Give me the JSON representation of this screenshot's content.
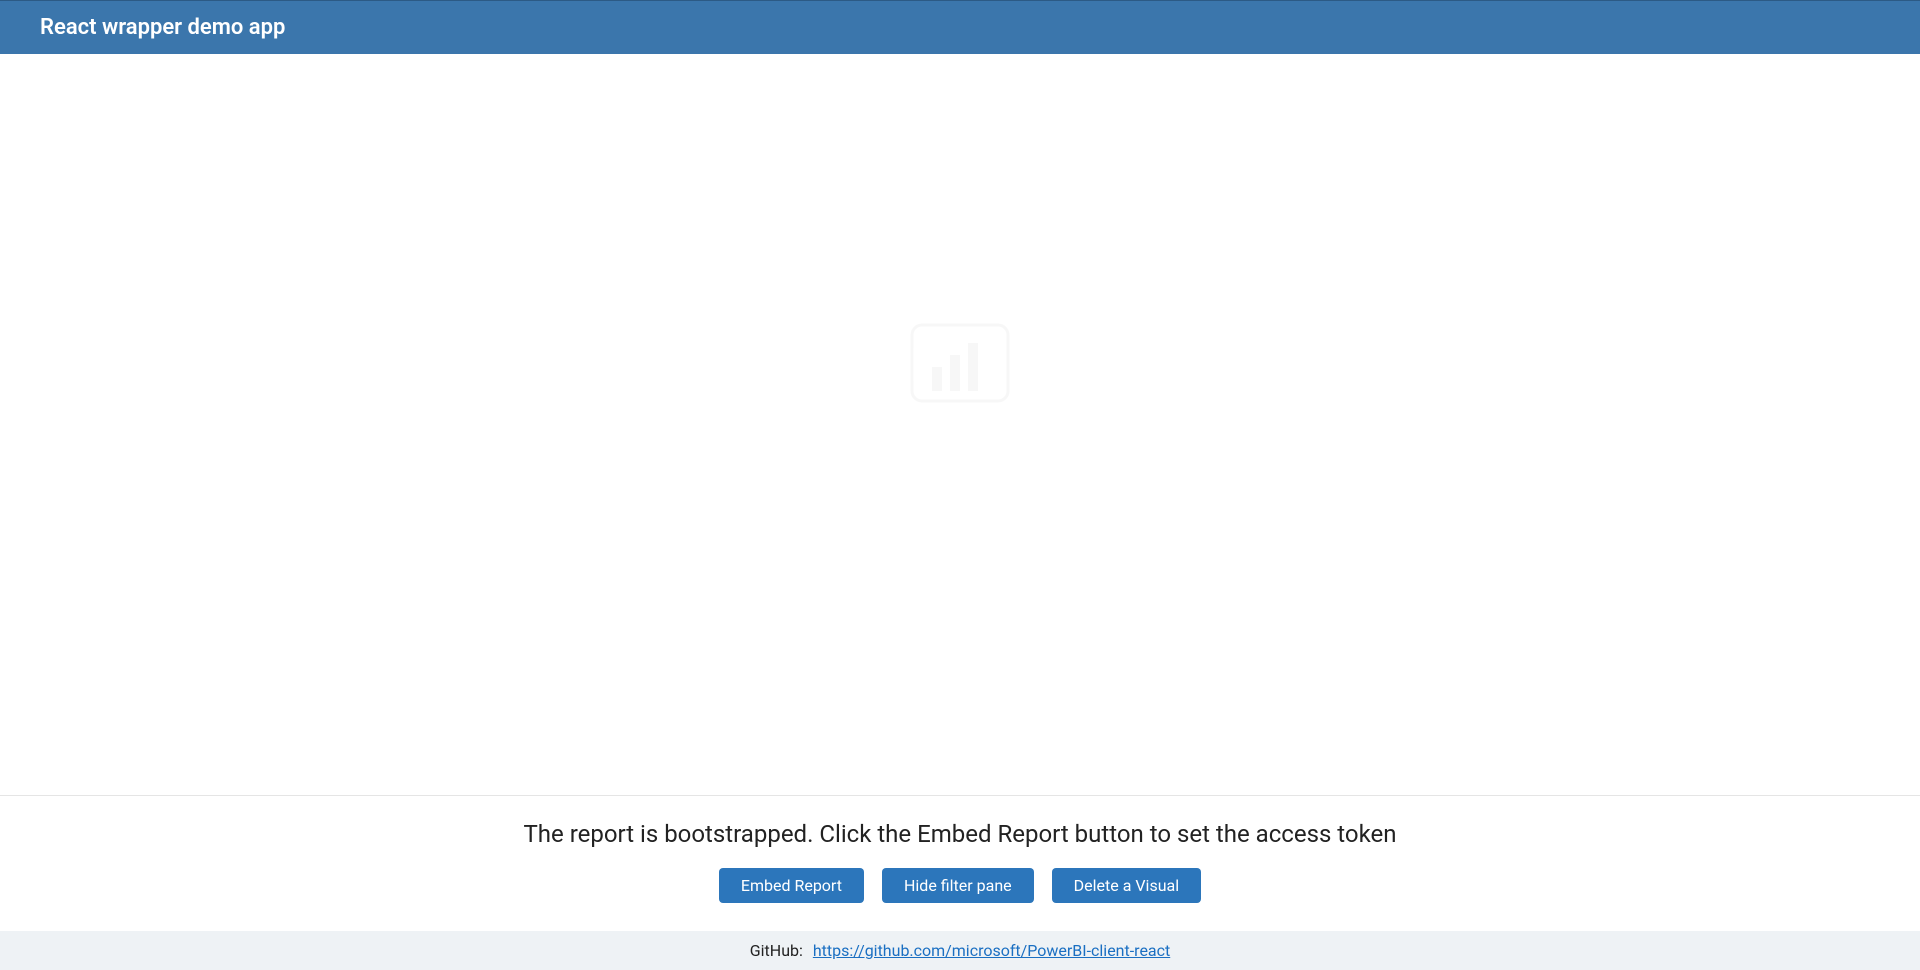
{
  "header": {
    "title": "React wrapper demo app"
  },
  "report": {
    "placeholder_icon": "powerbi-bars-icon"
  },
  "controls": {
    "status_text": "The report is bootstrapped. Click the Embed Report button to set the access token",
    "buttons": {
      "embed": "Embed Report",
      "hide_filter": "Hide filter pane",
      "delete_visual": "Delete a Visual"
    }
  },
  "footer": {
    "label": "GitHub:",
    "link_text": "https://github.com/microsoft/PowerBI-client-react"
  }
}
